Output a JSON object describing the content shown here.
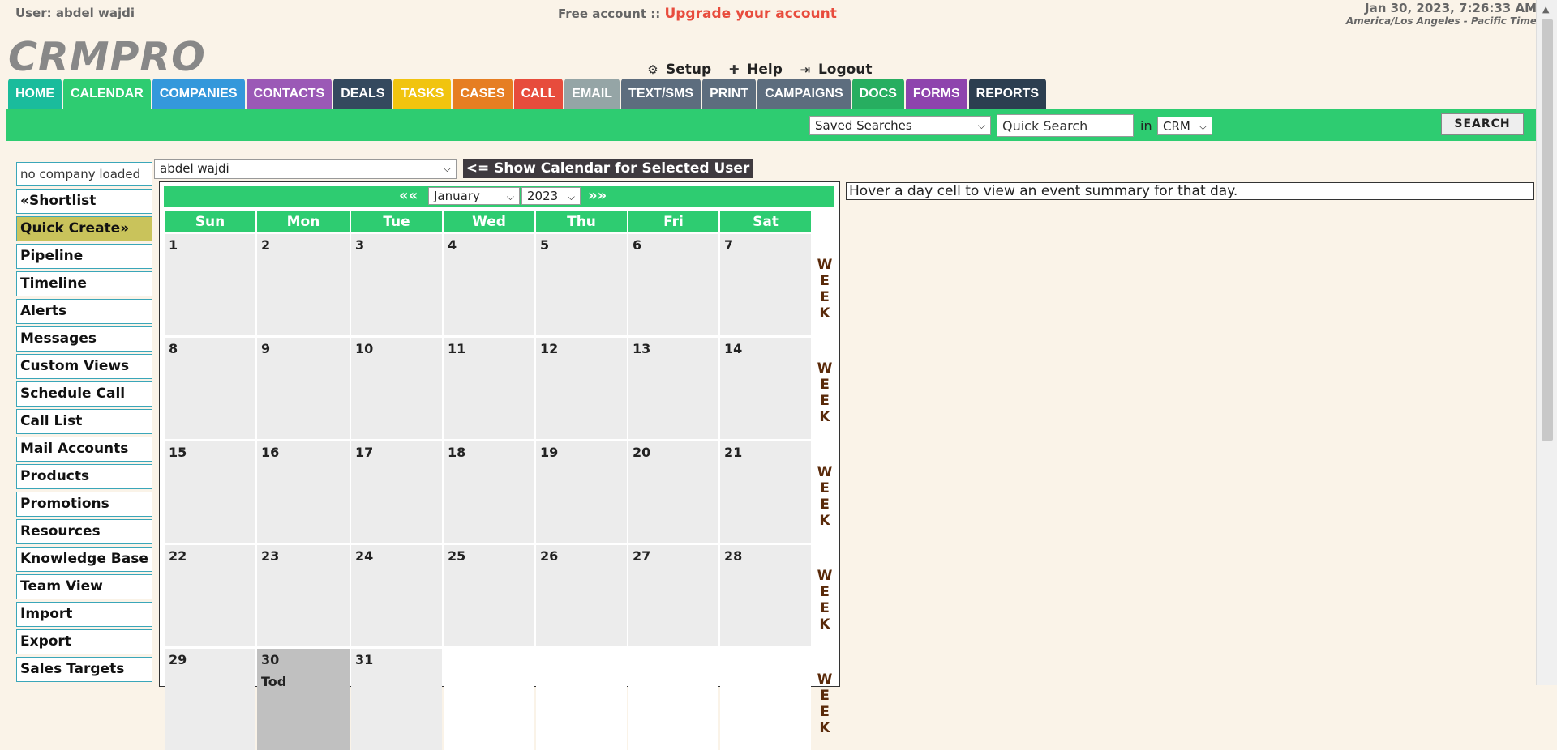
{
  "header": {
    "user_label": "User: abdel wajdi",
    "account_label": "Free account ::",
    "upgrade_link": "Upgrade your account",
    "datetime": "Jan 30, 2023, 7:26:33 AM",
    "timezone": "America/Los Angeles - Pacific Time",
    "logo": "CRMPRO",
    "setup": "Setup",
    "help": "Help",
    "logout": "Logout"
  },
  "nav": {
    "tabs": [
      {
        "label": "HOME",
        "color": "#1abc9c"
      },
      {
        "label": "CALENDAR",
        "color": "#2ecc71"
      },
      {
        "label": "COMPANIES",
        "color": "#3498db"
      },
      {
        "label": "CONTACTS",
        "color": "#9b59b6"
      },
      {
        "label": "DEALS",
        "color": "#34495e"
      },
      {
        "label": "TASKS",
        "color": "#f1c40f"
      },
      {
        "label": "CASES",
        "color": "#e67e22"
      },
      {
        "label": "CALL",
        "color": "#e74c3c"
      },
      {
        "label": "EMAIL",
        "color": "#95a5a6"
      },
      {
        "label": "TEXT/SMS",
        "color": "#5d6d7e"
      },
      {
        "label": "PRINT",
        "color": "#5d6d7e"
      },
      {
        "label": "CAMPAIGNS",
        "color": "#5d6d7e"
      },
      {
        "label": "DOCS",
        "color": "#27ae60"
      },
      {
        "label": "FORMS",
        "color": "#8e44ad"
      },
      {
        "label": "REPORTS",
        "color": "#2c3e50"
      }
    ]
  },
  "searchbar": {
    "saved_searches": "Saved Searches",
    "quick_search_placeholder": "Quick Search",
    "in_label": "in",
    "scope": "CRM",
    "search_button": "SEARCH"
  },
  "sidebar": {
    "company": "no company loaded",
    "items": [
      "«Shortlist",
      "Quick Create»",
      "Pipeline",
      "Timeline",
      "Alerts",
      "Messages",
      "Custom Views",
      "Schedule Call",
      "Call List",
      "Mail Accounts",
      "Products",
      "Promotions",
      "Resources",
      "Knowledge Base",
      "Team View",
      "Import",
      "Export",
      "Sales Targets"
    ]
  },
  "calendar": {
    "user": "abdel wajdi",
    "show_button": "<= Show Calendar for Selected User",
    "prev": "««",
    "next": "»»",
    "month": "January",
    "year": "2023",
    "days": [
      "Sun",
      "Mon",
      "Tue",
      "Wed",
      "Thu",
      "Fri",
      "Sat"
    ],
    "week_label": "WEEK",
    "today_label": "Tod",
    "weeks": [
      [
        "1",
        "2",
        "3",
        "4",
        "5",
        "6",
        "7"
      ],
      [
        "8",
        "9",
        "10",
        "11",
        "12",
        "13",
        "14"
      ],
      [
        "15",
        "16",
        "17",
        "18",
        "19",
        "20",
        "21"
      ],
      [
        "22",
        "23",
        "24",
        "25",
        "26",
        "27",
        "28"
      ],
      [
        "29",
        "30",
        "31",
        "",
        "",
        "",
        ""
      ]
    ],
    "today": "30",
    "summary": "Hover a day cell to view an event summary for that day."
  },
  "colors": {
    "accent_green": "#2ecc71",
    "background": "#faf3e8",
    "upgrade": "#e84c3d"
  }
}
